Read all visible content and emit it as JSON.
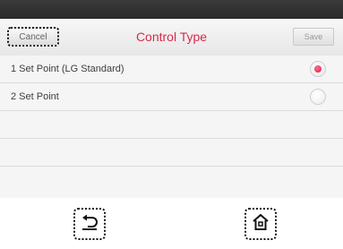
{
  "header": {
    "cancel_label": "Cancel",
    "title": "Control Type",
    "save_label": "Save"
  },
  "options": [
    {
      "label": "1 Set Point (LG Standard)",
      "selected": true
    },
    {
      "label": "2 Set Point",
      "selected": false
    }
  ],
  "nav": {
    "back_icon": "back-arrow-icon",
    "home_icon": "home-icon"
  },
  "colors": {
    "accent": "#d72a4a",
    "topbar": "#2f2f2f",
    "list_background": "#f5f5f5"
  }
}
